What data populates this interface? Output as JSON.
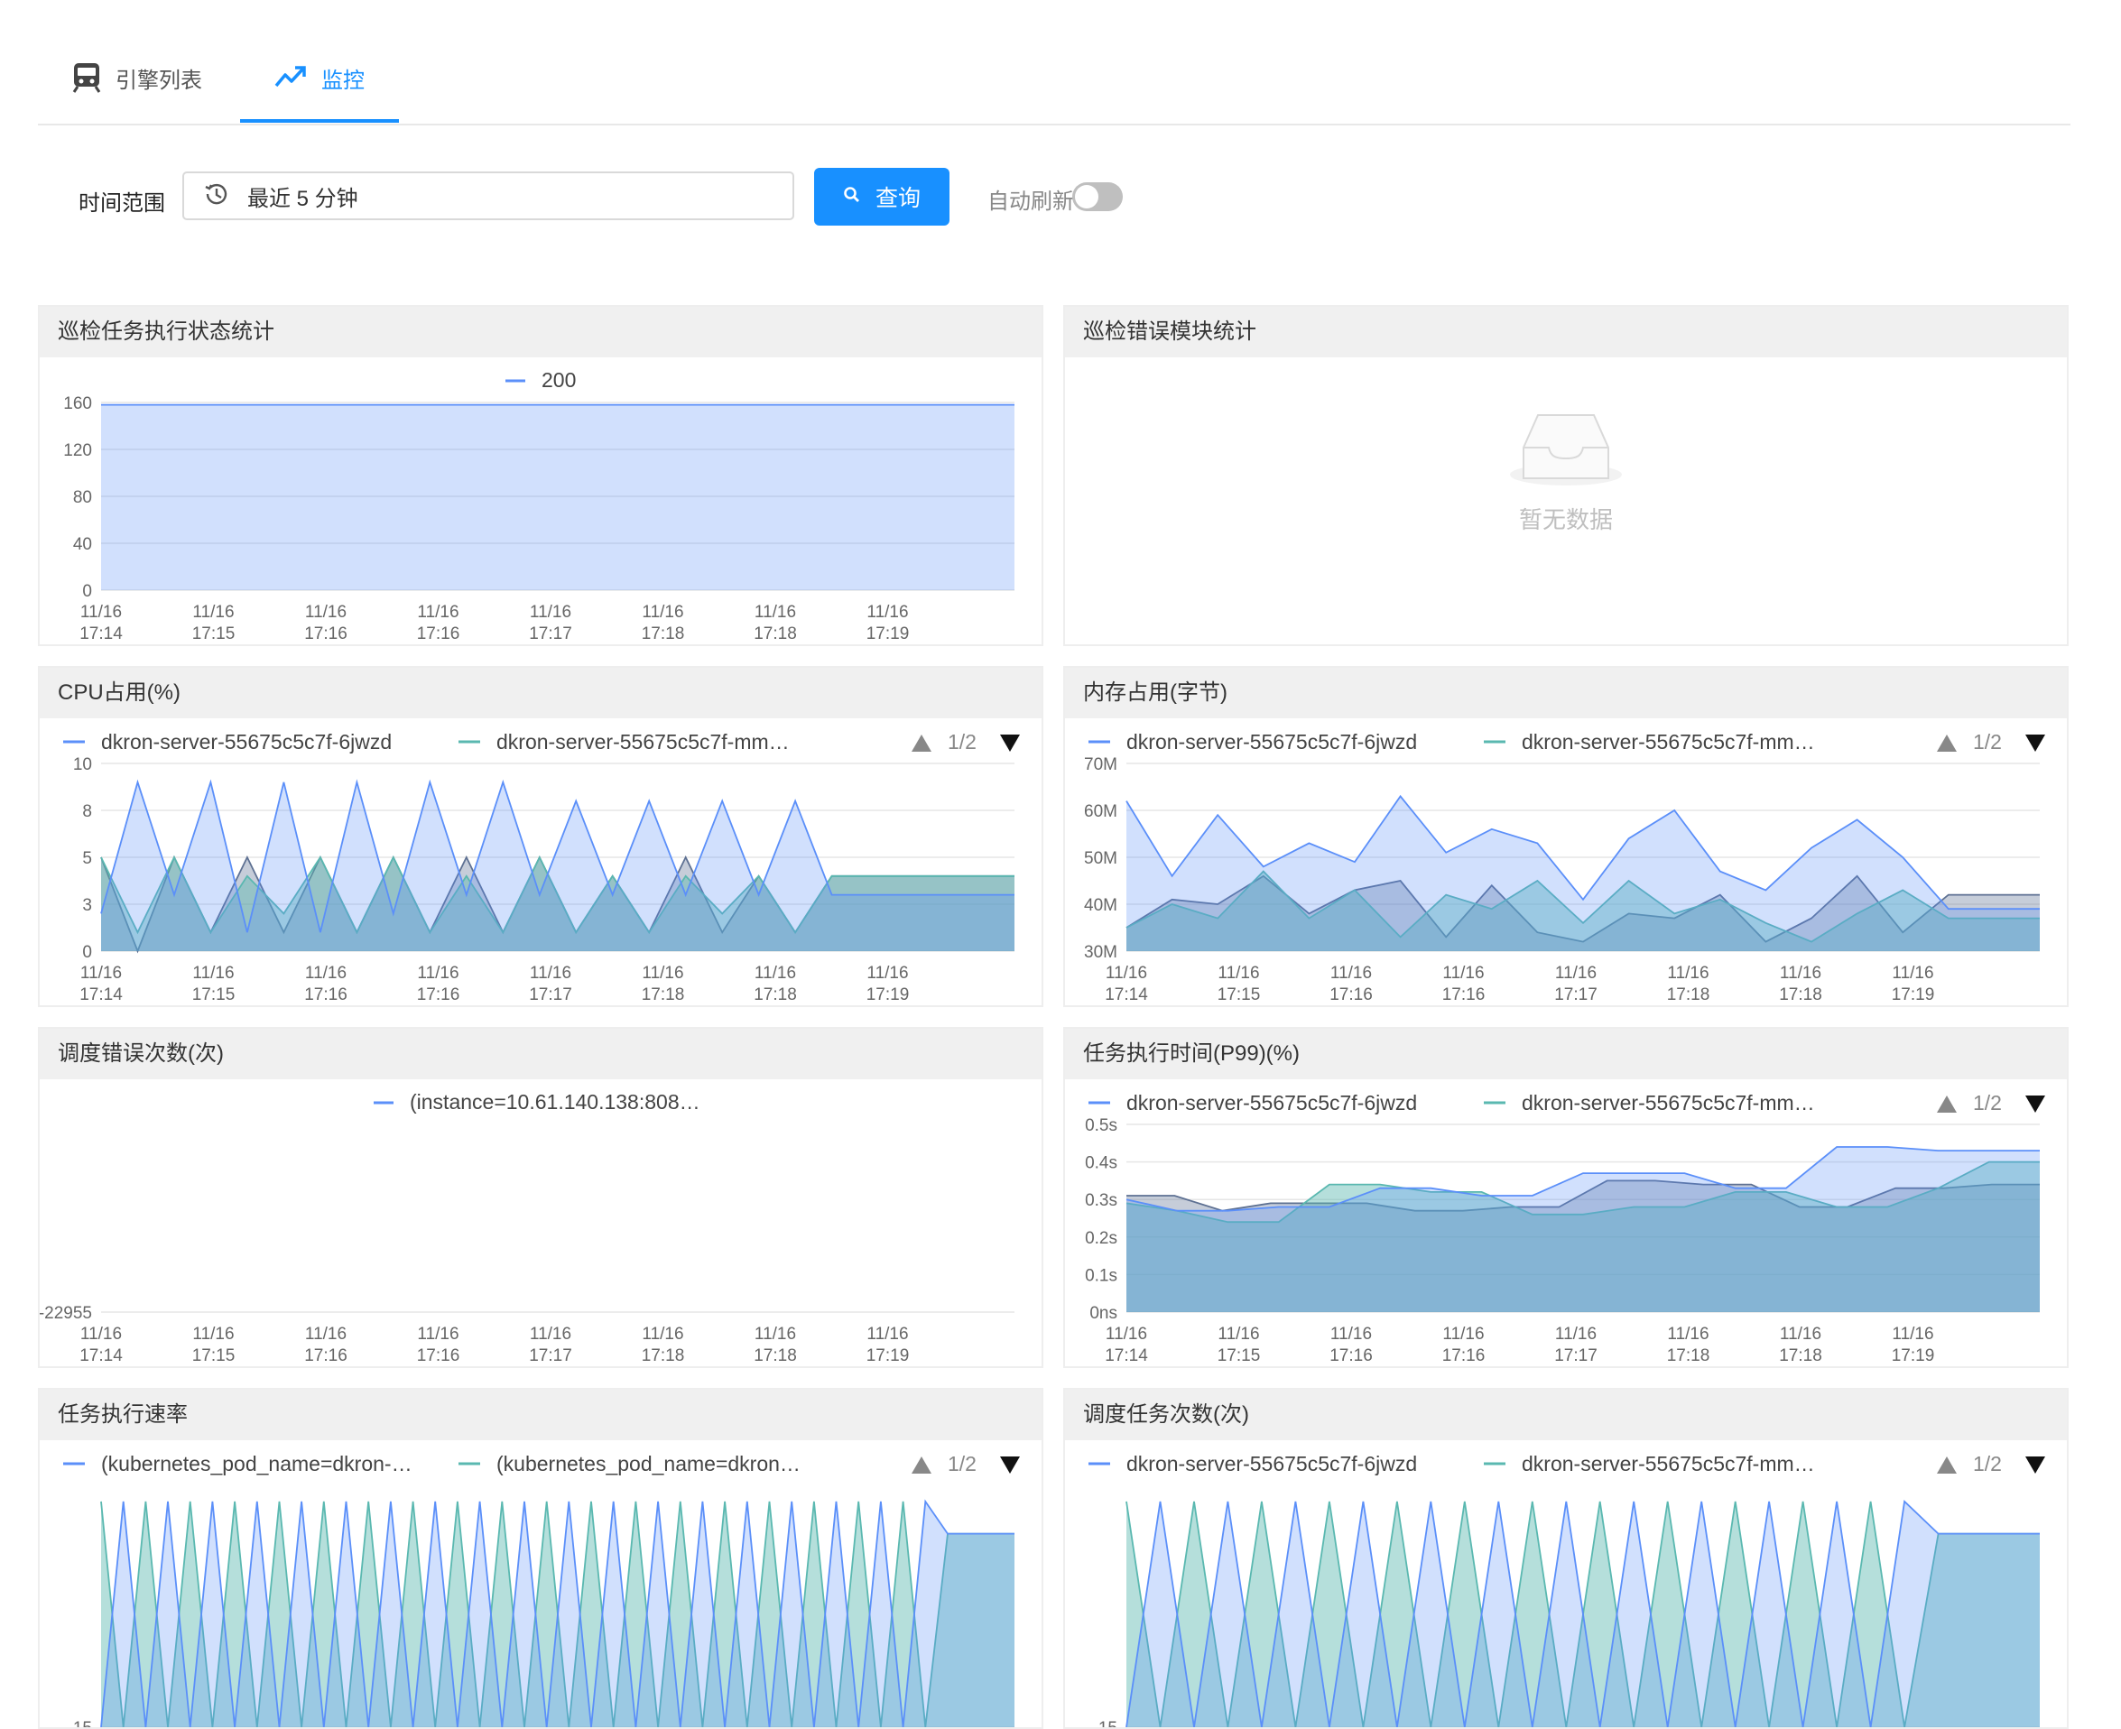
{
  "tabs": [
    {
      "label": "引擎列表",
      "icon": "train-icon",
      "active": false
    },
    {
      "label": "监控",
      "icon": "trend-up-icon",
      "active": true
    }
  ],
  "filter": {
    "label": "时间范围",
    "time_range_value": "最近 5 分钟",
    "query_label": "查询",
    "auto_refresh_label": "自动刷新",
    "auto_refresh_on": false
  },
  "colors": {
    "accent": "#1890ff",
    "series1": "#5b8ff9",
    "series2": "#5ab8b0",
    "series3": "#5d7092"
  },
  "panels": {
    "task_status": {
      "title": "巡检任务执行状态统计"
    },
    "error_module": {
      "title": "巡检错误模块统计",
      "empty_text": "暂无数据",
      "icon": "empty-inbox-icon"
    },
    "cpu": {
      "title": "CPU占用(%)"
    },
    "memory": {
      "title": "内存占用(字节)"
    },
    "sched_errors": {
      "title": "调度错误次数(次)"
    },
    "exec_time": {
      "title": "任务执行时间(P99)(%)"
    },
    "exec_rate": {
      "title": "任务执行速率"
    },
    "sched_count": {
      "title": "调度任务次数(次)"
    }
  },
  "chart_data": [
    {
      "id": "task_status",
      "type": "area",
      "x": [
        "11/16 17:14",
        "11/16 17:15",
        "11/16 17:16",
        "11/16 17:16",
        "11/16 17:17",
        "11/16 17:18",
        "11/16 17:18",
        "11/16 17:19"
      ],
      "yticks": [
        "0",
        "40",
        "80",
        "120",
        "160"
      ],
      "ylim": [
        0,
        160
      ],
      "series": [
        {
          "name": "200",
          "values": [
            158,
            158,
            158,
            158,
            158,
            158,
            158,
            158,
            158,
            158,
            158,
            158,
            158,
            158,
            158,
            158,
            158,
            158,
            158,
            158,
            158
          ]
        }
      ],
      "legend": {
        "items": [
          "200"
        ],
        "placement": "top-center"
      }
    },
    {
      "id": "cpu",
      "type": "area",
      "x": [
        "11/16 17:14",
        "11/16 17:15",
        "11/16 17:16",
        "11/16 17:16",
        "11/16 17:17",
        "11/16 17:18",
        "11/16 17:18",
        "11/16 17:19"
      ],
      "yticks": [
        "0",
        "3",
        "5",
        "8",
        "10"
      ],
      "ylim": [
        0,
        10
      ],
      "series": [
        {
          "name": "dkron-server-55675c5c7f-6jwzd",
          "values": [
            2,
            9,
            3,
            9,
            1,
            9,
            1,
            9,
            2,
            9,
            3,
            9,
            3,
            8,
            3,
            8,
            3,
            8,
            3,
            8,
            3,
            3,
            3,
            3,
            3,
            3
          ]
        },
        {
          "name": "dkron-server-55675c5c7f-mm…",
          "values": [
            5,
            1,
            5,
            1,
            4,
            2,
            5,
            1,
            5,
            1,
            4,
            1,
            5,
            1,
            4,
            1,
            4,
            2,
            4,
            1,
            4,
            4,
            4,
            4,
            4,
            4
          ]
        },
        {
          "name": "",
          "values": [
            5,
            0,
            5,
            1,
            5,
            1,
            5,
            1,
            5,
            1,
            5,
            1,
            5,
            1,
            4,
            1,
            5,
            1,
            4,
            1,
            4,
            4,
            4,
            4,
            4,
            4
          ]
        }
      ],
      "legend": {
        "items": [
          "dkron-server-55675c5c7f-6jwzd",
          "dkron-server-55675c5c7f-mm…"
        ],
        "page": "1/2",
        "placement": "top"
      }
    },
    {
      "id": "memory",
      "type": "area",
      "x": [
        "11/16 17:14",
        "11/16 17:15",
        "11/16 17:16",
        "11/16 17:16",
        "11/16 17:17",
        "11/16 17:18",
        "11/16 17:18",
        "11/16 17:19"
      ],
      "yticks": [
        "30M",
        "40M",
        "50M",
        "60M",
        "70M"
      ],
      "ylim": [
        30,
        70
      ],
      "series": [
        {
          "name": "dkron-server-55675c5c7f-6jwzd",
          "values": [
            62,
            46,
            59,
            48,
            53,
            49,
            63,
            51,
            56,
            53,
            41,
            54,
            60,
            47,
            43,
            52,
            58,
            50,
            39,
            39,
            39
          ]
        },
        {
          "name": "dkron-server-55675c5c7f-mm…",
          "values": [
            35,
            40,
            37,
            47,
            37,
            43,
            33,
            42,
            39,
            45,
            36,
            45,
            38,
            41,
            36,
            32,
            38,
            43,
            37,
            37,
            37
          ]
        },
        {
          "name": "",
          "values": [
            35,
            41,
            40,
            46,
            38,
            43,
            45,
            33,
            44,
            34,
            32,
            38,
            37,
            42,
            32,
            37,
            46,
            34,
            42,
            42,
            42
          ]
        }
      ],
      "legend": {
        "items": [
          "dkron-server-55675c5c7f-6jwzd",
          "dkron-server-55675c5c7f-mm…"
        ],
        "page": "1/2",
        "placement": "top"
      }
    },
    {
      "id": "sched_errors",
      "type": "line",
      "x": [
        "11/16 17:14",
        "11/16 17:15",
        "11/16 17:16",
        "11/16 17:16",
        "11/16 17:17",
        "11/16 17:18",
        "11/16 17:18",
        "11/16 17:19"
      ],
      "yticks": [
        "-22955"
      ],
      "series": [
        {
          "name": "(instance=10.61.140.138:808…",
          "values": [
            -22955,
            -22955,
            -22955,
            -22955,
            -22955,
            -22955,
            -22955,
            -22955,
            -22955,
            -22955,
            -22955,
            -22955,
            -22955,
            -22955,
            -22955,
            -22955,
            -22955,
            -22955,
            -22955,
            -22955,
            -22955
          ]
        }
      ],
      "legend": {
        "items": [
          "(instance=10.61.140.138:808…"
        ],
        "placement": "top-center"
      }
    },
    {
      "id": "exec_time",
      "type": "area",
      "x": [
        "11/16 17:14",
        "11/16 17:15",
        "11/16 17:16",
        "11/16 17:16",
        "11/16 17:17",
        "11/16 17:18",
        "11/16 17:18",
        "11/16 17:19"
      ],
      "yticks": [
        "0ns",
        "0.1s",
        "0.2s",
        "0.3s",
        "0.4s",
        "0.5s"
      ],
      "ylim": [
        0,
        0.5
      ],
      "series": [
        {
          "name": "dkron-server-55675c5c7f-6jwzd",
          "values": [
            0.3,
            0.27,
            0.27,
            0.28,
            0.28,
            0.33,
            0.33,
            0.31,
            0.31,
            0.37,
            0.37,
            0.37,
            0.33,
            0.33,
            0.44,
            0.44,
            0.43,
            0.43,
            0.43
          ]
        },
        {
          "name": "dkron-server-55675c5c7f-mm…",
          "values": [
            0.29,
            0.27,
            0.24,
            0.24,
            0.34,
            0.34,
            0.32,
            0.32,
            0.26,
            0.26,
            0.28,
            0.28,
            0.32,
            0.32,
            0.28,
            0.28,
            0.33,
            0.4,
            0.4
          ]
        },
        {
          "name": "",
          "values": [
            0.31,
            0.31,
            0.27,
            0.29,
            0.29,
            0.29,
            0.27,
            0.27,
            0.28,
            0.28,
            0.35,
            0.35,
            0.34,
            0.34,
            0.28,
            0.28,
            0.33,
            0.33,
            0.34,
            0.34
          ]
        }
      ],
      "legend": {
        "items": [
          "dkron-server-55675c5c7f-6jwzd",
          "dkron-server-55675c5c7f-mm…"
        ],
        "page": "1/2",
        "placement": "top"
      }
    },
    {
      "id": "exec_rate",
      "type": "area",
      "x": [],
      "yticks": [
        "15"
      ],
      "ylim": [
        0,
        15
      ],
      "series": [
        {
          "name": "(kubernetes_pod_name=dkron-…",
          "values": [
            0,
            14,
            0,
            14,
            0,
            14,
            0,
            14,
            0,
            14,
            0,
            14,
            0,
            14,
            0,
            14,
            0,
            14,
            0,
            14,
            0,
            14,
            0,
            14,
            0,
            14,
            0,
            14,
            0,
            14,
            0,
            14,
            0,
            14,
            0,
            14,
            0,
            14,
            12,
            12,
            12,
            12
          ]
        },
        {
          "name": "(kubernetes_pod_name=dkron…",
          "values": [
            14,
            0,
            14,
            0,
            14,
            0,
            14,
            0,
            14,
            0,
            14,
            0,
            14,
            0,
            14,
            0,
            14,
            0,
            14,
            0,
            14,
            0,
            14,
            0,
            14,
            0,
            14,
            0,
            14,
            0,
            14,
            0,
            14,
            0,
            14,
            0,
            14,
            0,
            12,
            12,
            12,
            12
          ]
        }
      ],
      "legend": {
        "items": [
          "(kubernetes_pod_name=dkron-…",
          "(kubernetes_pod_name=dkron…"
        ],
        "page": "1/2",
        "placement": "top"
      }
    },
    {
      "id": "sched_count",
      "type": "area",
      "x": [],
      "yticks": [
        "15"
      ],
      "ylim": [
        0,
        15
      ],
      "series": [
        {
          "name": "dkron-server-55675c5c7f-6jwzd",
          "values": [
            0,
            14,
            0,
            14,
            0,
            14,
            0,
            14,
            0,
            14,
            0,
            14,
            0,
            14,
            0,
            14,
            0,
            14,
            0,
            14,
            0,
            14,
            0,
            14,
            12,
            12,
            12,
            12
          ]
        },
        {
          "name": "dkron-server-55675c5c7f-mm…",
          "values": [
            14,
            0,
            14,
            0,
            14,
            0,
            14,
            0,
            14,
            0,
            14,
            0,
            14,
            0,
            14,
            0,
            14,
            0,
            14,
            0,
            14,
            0,
            14,
            0,
            12,
            12,
            12,
            12
          ]
        }
      ],
      "legend": {
        "items": [
          "dkron-server-55675c5c7f-6jwzd",
          "dkron-server-55675c5c7f-mm…"
        ],
        "page": "1/2",
        "placement": "top"
      }
    }
  ]
}
